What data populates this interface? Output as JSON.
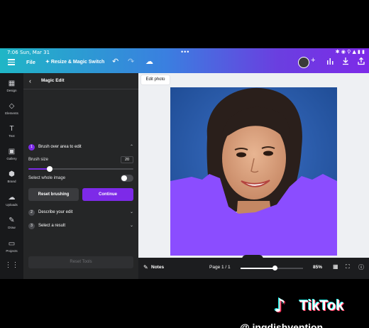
{
  "status": {
    "time": "7:06 Sun, Mar 31",
    "dots": "•••",
    "indicators": "✱ ◉ ⚲ ▲ ▮ ▮"
  },
  "topbar": {
    "file_label": "File",
    "resize_label": "Resize & Magic Switch",
    "icons": [
      "menu-icon",
      "undo-icon",
      "redo-icon",
      "cloud-icon",
      "avatar",
      "plus-icon",
      "chart-icon",
      "download-icon",
      "share-icon"
    ]
  },
  "rail": {
    "items": [
      {
        "label": "Design",
        "icon": "▦"
      },
      {
        "label": "Elements",
        "icon": "◇"
      },
      {
        "label": "Text",
        "icon": "T"
      },
      {
        "label": "Gallery",
        "icon": "▣"
      },
      {
        "label": "Brand",
        "icon": "⬢"
      },
      {
        "label": "Uploads",
        "icon": "☁"
      },
      {
        "label": "Draw",
        "icon": "✎"
      },
      {
        "label": "Projects",
        "icon": "▭"
      },
      {
        "label": "",
        "icon": "⋮⋮"
      }
    ]
  },
  "panel": {
    "title": "Magic Edit",
    "step1": {
      "num": "1",
      "label": "Brush over area to edit"
    },
    "brush_size_label": "Brush size",
    "brush_size_value": "20",
    "brush_size_fraction": 0.2,
    "select_whole_image_label": "Select whole image",
    "select_whole_image_on": false,
    "reset_brushing_label": "Reset brushing",
    "continue_label": "Continue",
    "step2": {
      "num": "2",
      "label": "Describe your edit"
    },
    "step3": {
      "num": "3",
      "label": "Select a result"
    },
    "reset_tools_label": "Reset Tools"
  },
  "canvas": {
    "edit_photo_label": "Edit photo"
  },
  "bottombar": {
    "notes_label": "Notes",
    "page_label": "Page 1 / 1",
    "zoom_value": "85%",
    "zoom_fraction": 0.55
  },
  "watermark": {
    "brand": "TikTok",
    "note": "♪",
    "handle": "@ ingdishvention"
  },
  "colors": {
    "accent": "#7d2ae8",
    "panel_bg": "#252627",
    "rail_bg": "#18191b",
    "brush_overlay": "#8b4dff"
  }
}
